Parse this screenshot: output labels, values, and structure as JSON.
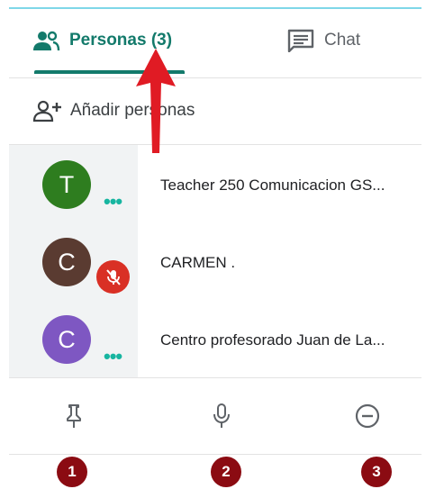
{
  "tabs": {
    "people_label": "Personas (3)",
    "chat_label": "Chat"
  },
  "add_people": {
    "label": "Añadir personas"
  },
  "participants": [
    {
      "initial": "T",
      "name": "Teacher 250 Comunicacion GS...",
      "avatar_color": "#2e7d1f",
      "status": "dots"
    },
    {
      "initial": "C",
      "name": "CARMEN .",
      "avatar_color": "#5a3b31",
      "status": "muted"
    },
    {
      "initial": "C",
      "name": "Centro profesorado Juan de La...",
      "avatar_color": "#7e57c2",
      "status": "dots"
    }
  ],
  "toolbar": {
    "icons": [
      "pin-icon",
      "mic-icon",
      "remove-icon"
    ]
  },
  "badges": [
    "1",
    "2",
    "3"
  ],
  "colors": {
    "accent": "#137a6b",
    "badge": "#8b0b12",
    "mute": "#d93025",
    "arrow": "#e01b24"
  }
}
